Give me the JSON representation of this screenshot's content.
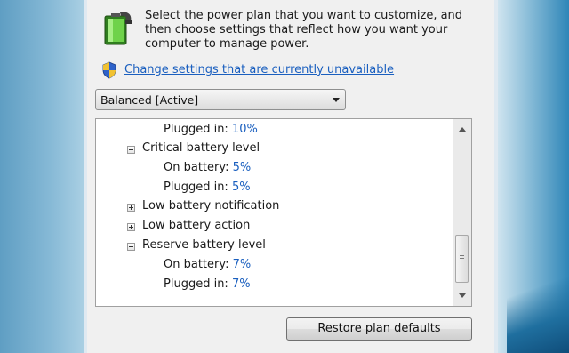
{
  "intro": {
    "line1": "Select the power plan that you want to customize, and",
    "line2": "then choose settings that reflect how you want your",
    "line3": "computer to manage power."
  },
  "change_link": "Change settings that are currently unavailable",
  "plan_select": {
    "value": "Balanced [Active]"
  },
  "tree": {
    "rows": [
      {
        "label": "Plugged in:",
        "value": "10%"
      },
      {
        "label": "Critical battery level",
        "expander": "minus"
      },
      {
        "label": "On battery:",
        "value": "5%"
      },
      {
        "label": "Plugged in:",
        "value": "5%"
      },
      {
        "label": "Low battery notification",
        "expander": "plus"
      },
      {
        "label": "Low battery action",
        "expander": "plus"
      },
      {
        "label": "Reserve battery level",
        "expander": "minus"
      },
      {
        "label": "On battery:",
        "value": "7%"
      },
      {
        "label": "Plugged in:",
        "value": "7%"
      }
    ]
  },
  "restore_button": "Restore plan defaults",
  "colors": {
    "link": "#1a5fbf",
    "value": "#1a5fbf",
    "dialog_bg": "#f0f0f0"
  },
  "icons": [
    "battery-power-icon",
    "uac-shield-icon",
    "scroll-up-icon",
    "scroll-down-icon"
  ]
}
